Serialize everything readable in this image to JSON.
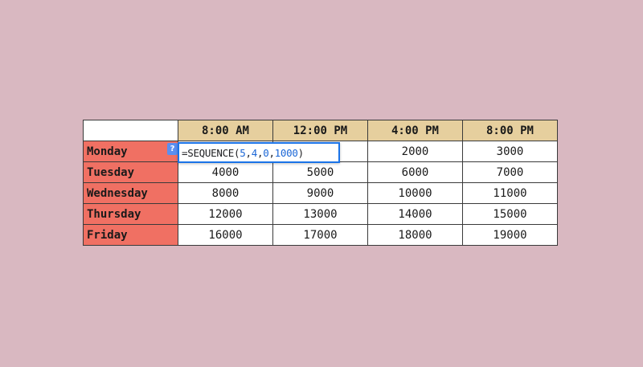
{
  "header": {
    "columns": [
      "8:00 AM",
      "12:00 PM",
      "4:00 PM",
      "8:00 PM"
    ]
  },
  "rows": [
    {
      "day": "Monday",
      "values": [
        "",
        "",
        "2000",
        "3000"
      ]
    },
    {
      "day": "Tuesday",
      "values": [
        "4000",
        "5000",
        "6000",
        "7000"
      ]
    },
    {
      "day": "Wednesday",
      "values": [
        "8000",
        "9000",
        "10000",
        "11000"
      ]
    },
    {
      "day": "Thursday",
      "values": [
        "12000",
        "13000",
        "14000",
        "15000"
      ]
    },
    {
      "day": "Friday",
      "values": [
        "16000",
        "17000",
        "18000",
        "19000"
      ]
    }
  ],
  "formula": {
    "prefix": "=SEQUENCE(",
    "arg1": "5",
    "sep1": ", ",
    "arg2": "4",
    "sep2": ", ",
    "arg3": "0",
    "sep3": ", ",
    "arg4": "1000",
    "suffix": ")"
  },
  "help": {
    "label": "?"
  },
  "colors": {
    "background": "#d9b8c1",
    "header_fill": "#e6cf9e",
    "day_fill": "#f07063",
    "formula_border": "#1a73e8",
    "formula_arg": "#1a66d6"
  }
}
